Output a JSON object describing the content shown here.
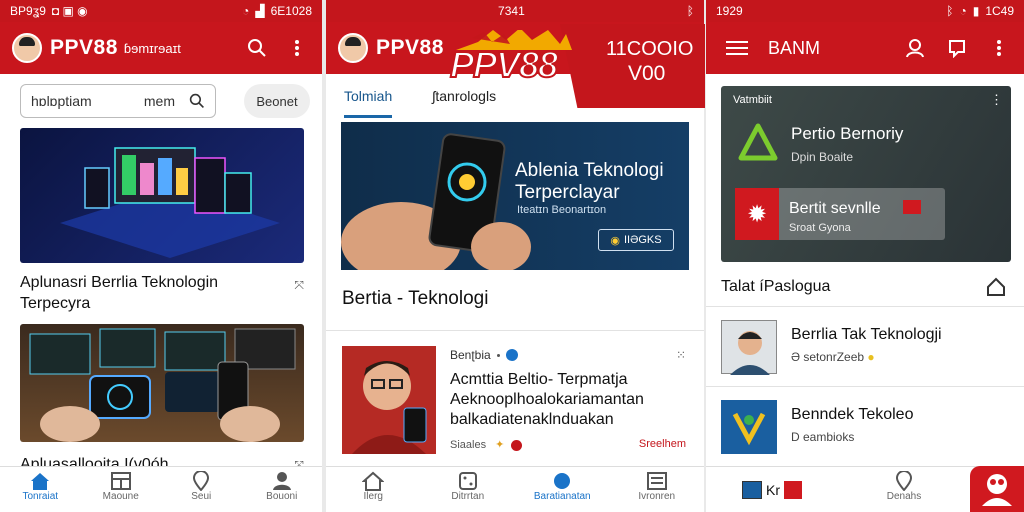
{
  "panel1": {
    "status": {
      "left": "BP9ʓ9",
      "time": "6E1028"
    },
    "brand": "PPV88",
    "brand_sub": "ɓɘmɪrɘaɪt",
    "search": {
      "value": "hɒlɒptiam",
      "suffix": "mem"
    },
    "chip": "Beonet",
    "card1_title": "Aplunasri Berrlia Teknologin Terpecyra",
    "card2_title": "Apluasallooita I(v0óh",
    "nav": [
      "Tonraiat",
      "Maoune",
      "Seui",
      "Bouoni"
    ]
  },
  "panel2": {
    "status": {
      "time": "7341"
    },
    "brand": "PPV88",
    "tabs": [
      "Tolmiah",
      "ʃtanrologls"
    ],
    "hero": {
      "title": "Ablenia Teknologi Terperclayar",
      "sub": "Iteatɪn Beonartɪon",
      "button": "IIƏGKS"
    },
    "section_title": "Bertia - Teknologi",
    "news": {
      "source": "Benʈbia",
      "title": "Acmttia Beltio- Terpmatja Aeknooplhoalokariamantan balkadiatenaklnduakan",
      "meta": "Siaales",
      "tag": "Sreelhem"
    },
    "nav": [
      "Ilerg",
      "Ditrrtan",
      "Baratianatan",
      "Ivronren"
    ]
  },
  "logo": {
    "text": "PPV88",
    "ribbon_line1": "11COOIO",
    "ribbon_line2": "V00"
  },
  "panel3": {
    "status": {
      "time": "1C49",
      "center": "1929"
    },
    "title": "BANM",
    "card": {
      "label": "Vatmbiit",
      "title": "Pertio Bernoriy",
      "sub": "Dpin Boaite",
      "pill_title": "Bertit sevnlle",
      "pill_sub": "Sroat Gyona"
    },
    "list_title": "Talat íPaslogua",
    "rows": [
      {
        "title": "Berrlia Tak Teknologji",
        "meta": "Ə setonrZeeb"
      },
      {
        "title": "Benndek Tekoleo",
        "meta": "D eambioks"
      }
    ],
    "nav": [
      "Kr",
      "Denahs"
    ]
  },
  "colors": {
    "brand_red": "#c8161d",
    "accent_blue": "#1a73c8"
  }
}
